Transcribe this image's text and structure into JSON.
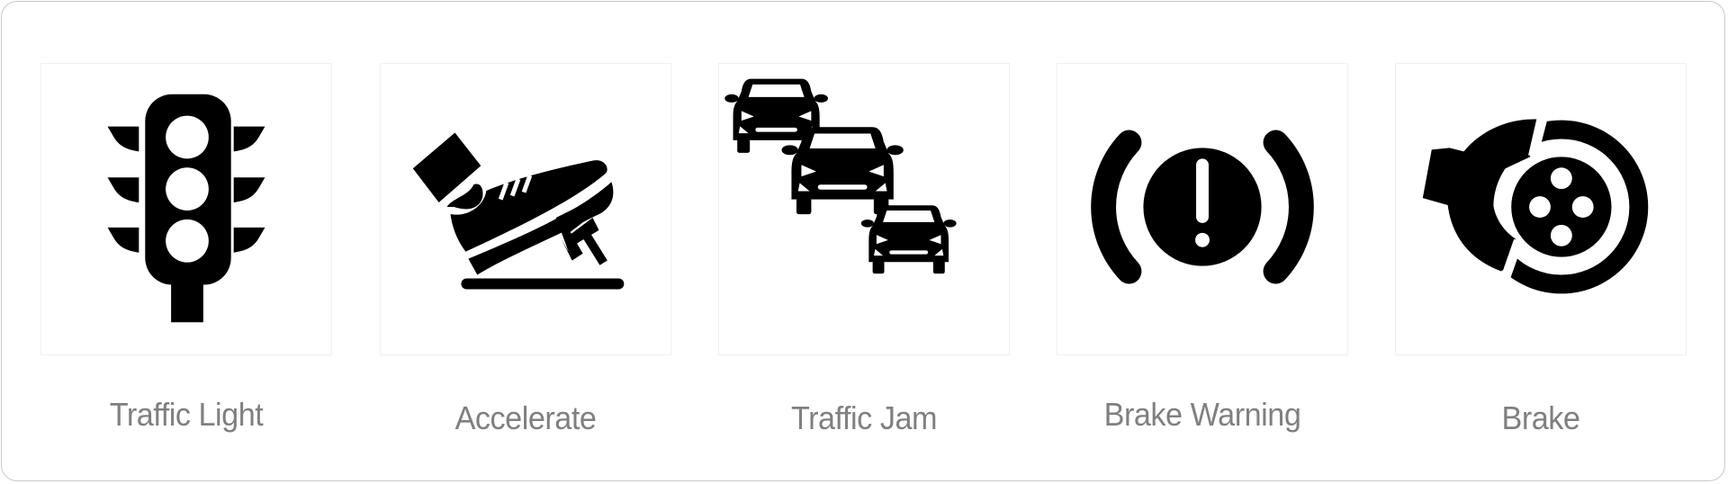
{
  "icons": [
    {
      "label": "Traffic Light",
      "icon": "traffic-light-icon"
    },
    {
      "label": "Accelerate",
      "icon": "accelerate-pedal-icon"
    },
    {
      "label": "Traffic Jam",
      "icon": "traffic-jam-icon"
    },
    {
      "label": "Brake Warning",
      "icon": "brake-warning-icon"
    },
    {
      "label": "Brake",
      "icon": "brake-disc-icon"
    }
  ],
  "colors": {
    "icon": "#000000",
    "label": "#808080",
    "frame": "#c9c9c9"
  }
}
